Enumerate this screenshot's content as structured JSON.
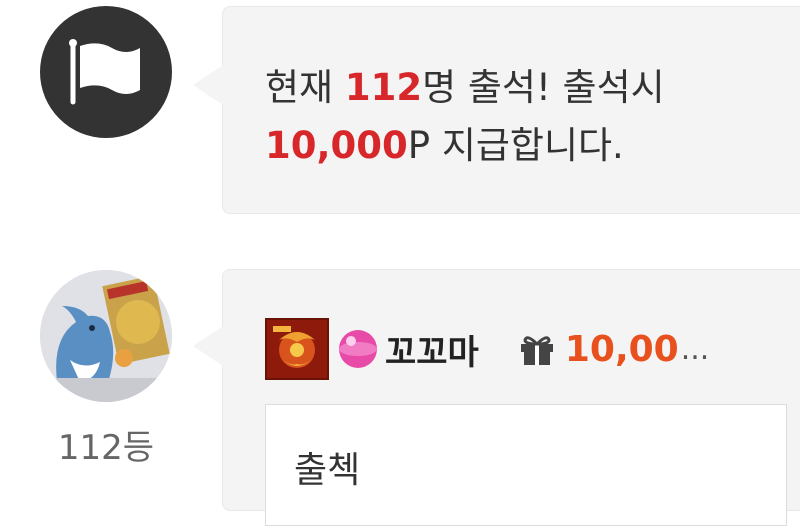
{
  "notice": {
    "icon": "flag-icon",
    "prefix": "현재 ",
    "count": "112",
    "middle": "명 출석! 출석시",
    "points": "10,000",
    "suffix": "P 지급합니다."
  },
  "comment": {
    "rank": "112등",
    "badge_icon": "level-badge-icon",
    "gem_icon": "pink-gem-icon",
    "nickname": "꼬꼬마",
    "gift_icon": "gift-icon",
    "points": "10,00",
    "points_ellipsis": "...",
    "text": "출첵"
  },
  "colors": {
    "highlight_red": "#d7272a",
    "points_orange": "#e8501e",
    "bubble_bg": "#f4f4f4",
    "dark_icon_bg": "#333333"
  }
}
